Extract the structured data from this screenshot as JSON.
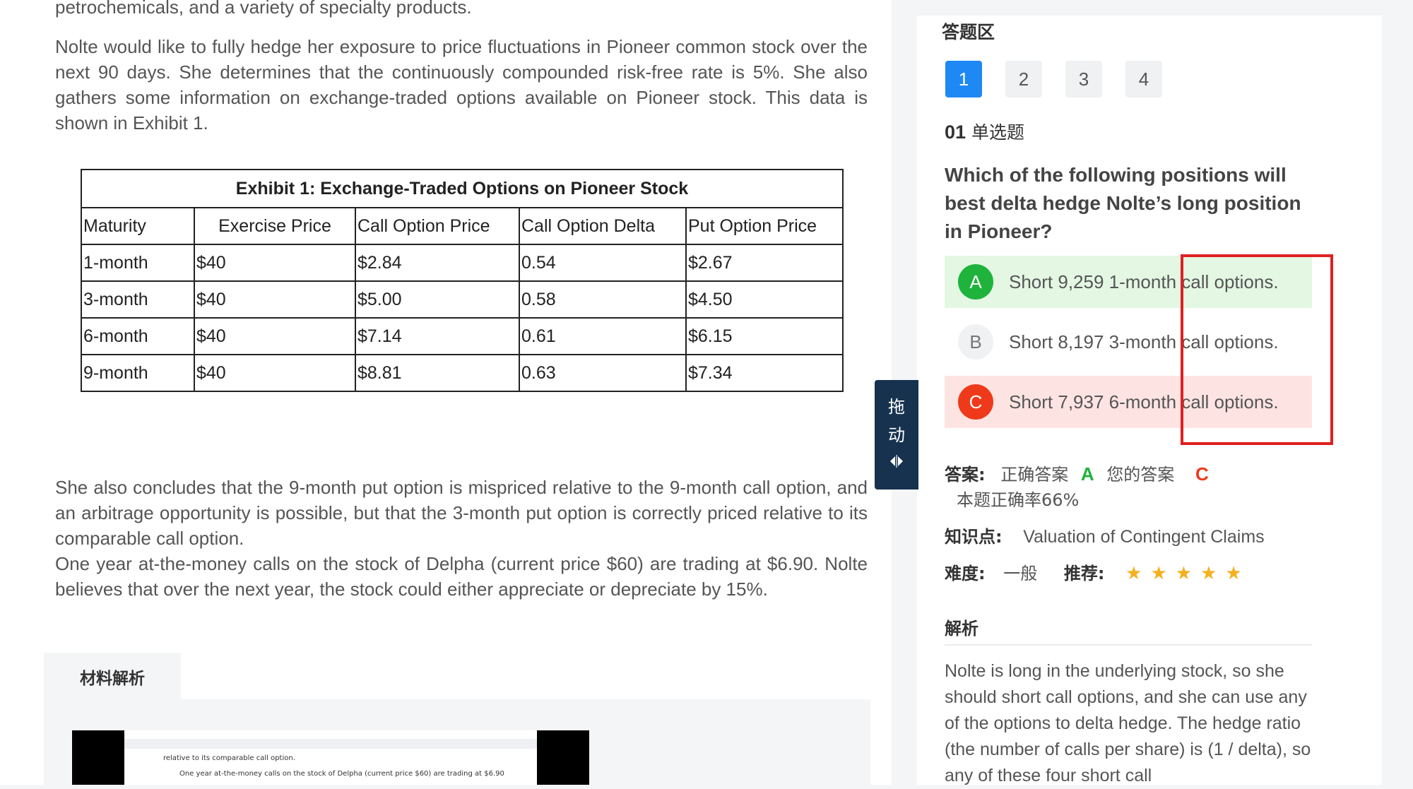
{
  "material": {
    "para1_clipped": "petrochemicals, and a variety of specialty products.",
    "para2": "Nolte would like to fully hedge her exposure to price fluctuations in Pioneer common stock over the next 90 days. She determines that the continuously compounded risk-free rate is 5%. She also gathers some information on exchange-traded options available on Pioneer stock. This data is shown in Exhibit 1.",
    "exhibit": {
      "title": "Exhibit 1: Exchange-Traded Options on Pioneer Stock",
      "headers": [
        "Maturity",
        "Exercise Price",
        "Call Option Price",
        "Call Option Delta",
        "Put Option Price"
      ],
      "rows": [
        [
          "1-month",
          "$40",
          "$2.84",
          "0.54",
          "$2.67"
        ],
        [
          "3-month",
          "$40",
          "$5.00",
          "0.58",
          "$4.50"
        ],
        [
          "6-month",
          "$40",
          "$7.14",
          "0.61",
          "$6.15"
        ],
        [
          "9-month",
          "$40",
          "$8.81",
          "0.63",
          "$7.34"
        ]
      ]
    },
    "para3": "She also concludes that the 9-month put option is mispriced relative to the 9-month call option, and an arbitrage opportunity is possible, but that the 3-month put option is correctly priced relative to its comparable call option.",
    "para4": "One year at-the-money calls on the stock of Delpha (current price $60) are trading at $6.90. Nolte believes that over the next year, the stock could either appreciate or depreciate by 15%.",
    "drag_label_1": "拖",
    "drag_label_2": "动",
    "analysis_tab": "材料解析",
    "thumb_line1": "relative to its comparable call option.",
    "thumb_line2": "One year at-the-money calls on the stock of Delpha (current price $60) are trading at $6.90"
  },
  "answer_panel": {
    "title": "答题区",
    "question_numbers": [
      "1",
      "2",
      "3",
      "4"
    ],
    "active_question": "1",
    "question_index": "01",
    "question_type": "单选题",
    "question_text": "Which of the following positions will best delta hedge Nolte’s long position in Pioneer?",
    "options": [
      {
        "letter": "A",
        "text": "Short 9,259 1-month call options.",
        "state": "correct"
      },
      {
        "letter": "B",
        "text": "Short 8,197 3-month call options.",
        "state": "none"
      },
      {
        "letter": "C",
        "text": "Short 7,937 6-month call options.",
        "state": "wrong"
      }
    ],
    "answer_label": "答案:",
    "correct_label": "正确答案",
    "correct_value": "A",
    "your_label": "您的答案",
    "your_value": "C",
    "accuracy": "本题正确率66%",
    "knowledge_label": "知识点:",
    "knowledge_value": "Valuation of Contingent Claims",
    "difficulty_label": "难度:",
    "difficulty_value": "一般",
    "recommend_label": "推荐:",
    "recommend_stars": 5,
    "star_glyph": "★",
    "analysis_title": "解析",
    "analysis_text": "Nolte is long in the underlying stock, so she should short call options, and she can use any of the options to delta hedge. The hedge ratio (the number of calls per share) is (1 / delta), so any of these four short call"
  },
  "colors": {
    "primary_blue": "#1e88f5",
    "correct_green": "#1fb33c",
    "wrong_red": "#ee3a1b",
    "highlight_box": "#e02020",
    "star": "#f5b01e",
    "drag_handle": "#16324f"
  }
}
